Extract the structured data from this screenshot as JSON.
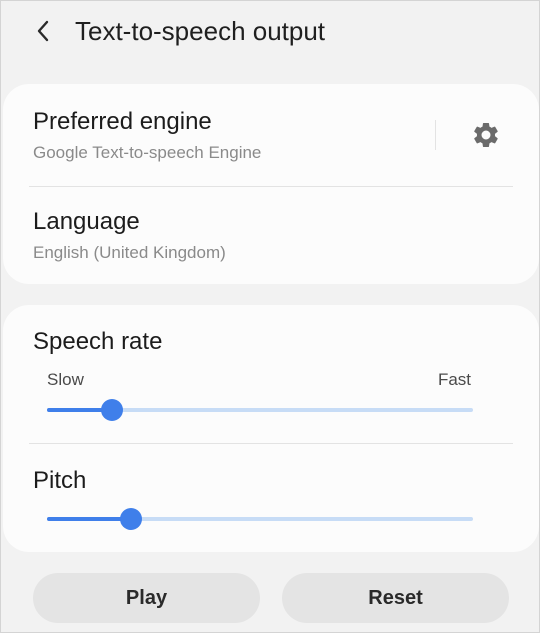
{
  "header": {
    "back_icon": "chevron-left-icon",
    "title": "Text-to-speech output"
  },
  "engine": {
    "title": "Preferred engine",
    "value": "Google Text-to-speech Engine",
    "settings_icon": "gear-icon"
  },
  "language": {
    "title": "Language",
    "value": "English (United Kingdom)"
  },
  "speech_rate": {
    "title": "Speech rate",
    "min_label": "Slow",
    "max_label": "Fast",
    "level": 0.153
  },
  "pitch": {
    "title": "Pitch",
    "level": 0.198
  },
  "actions": {
    "play_label": "Play",
    "reset_label": "Reset"
  },
  "colors": {
    "accent": "#3f7fea",
    "track": "#c7dcf6",
    "background": "#f2f2f2",
    "card": "#fcfcfc",
    "button": "#e4e4e4"
  }
}
